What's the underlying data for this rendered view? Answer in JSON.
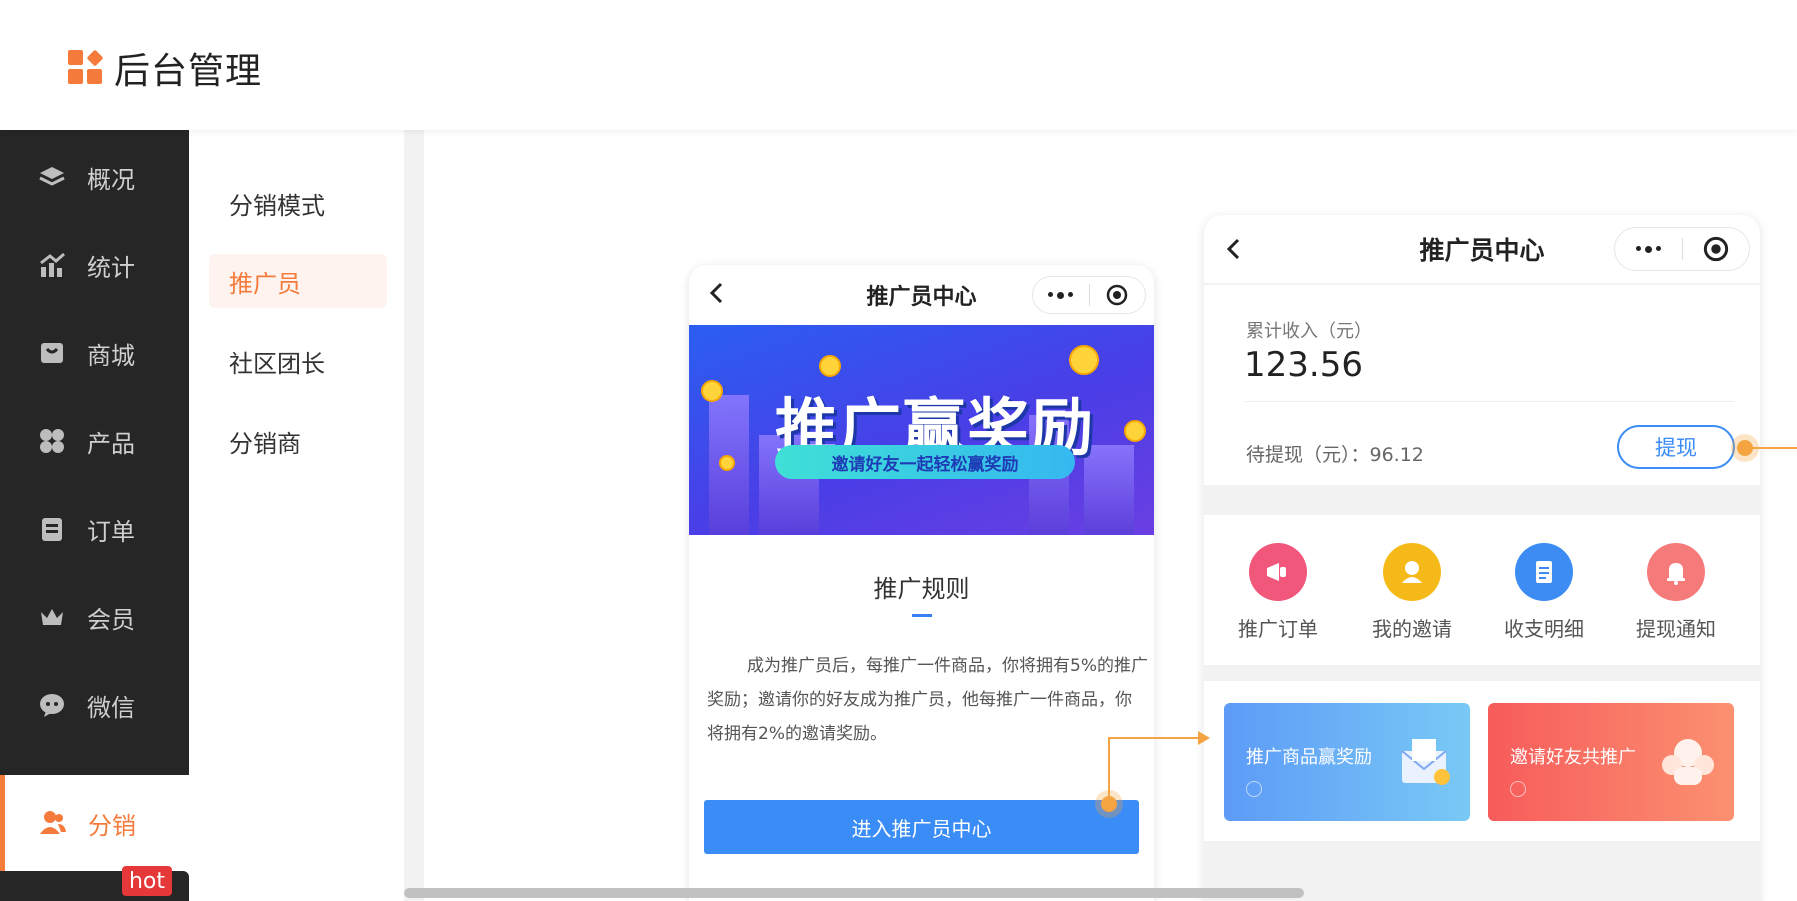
{
  "header": {
    "title": "后台管理"
  },
  "nav": {
    "items": [
      {
        "label": "概况",
        "icon": "layers-icon"
      },
      {
        "label": "统计",
        "icon": "chart-icon"
      },
      {
        "label": "商城",
        "icon": "store-icon"
      },
      {
        "label": "产品",
        "icon": "grid-icon"
      },
      {
        "label": "订单",
        "icon": "clipboard-icon"
      },
      {
        "label": "会员",
        "icon": "crown-icon"
      },
      {
        "label": "微信",
        "icon": "wechat-icon"
      },
      {
        "label": "分销",
        "icon": "users-icon"
      }
    ],
    "hot_badge": "hot"
  },
  "submenu": {
    "items": [
      {
        "label": "分销模式"
      },
      {
        "label": "推广员"
      },
      {
        "label": "社区团长"
      },
      {
        "label": "分销商"
      }
    ],
    "active": "推广员"
  },
  "phone_a": {
    "title": "推广员中心",
    "banner_title": "推广赢奖励",
    "banner_subtitle": "邀请好友一起轻松赢奖励",
    "rule_title": "推广规则",
    "rule_text": "成为推广员后，每推广一件商品，你将拥有5%的推广奖励；邀请你的好友成为推广员，他每推广一件商品，你将拥有2%的邀请奖励。",
    "enter_button": "进入推广员中心"
  },
  "phone_b": {
    "title": "推广员中心",
    "earnings_label": "累计收入（元）",
    "earnings_value": "123.56",
    "pending_label": "待提现（元）：96.12",
    "withdraw_button": "提现",
    "shortcuts": [
      {
        "label": "推广订单",
        "icon": "megaphone-icon",
        "color": "#f0577a"
      },
      {
        "label": "我的邀请",
        "icon": "invite-icon",
        "color": "#f6b91a"
      },
      {
        "label": "收支明细",
        "icon": "ledger-icon",
        "color": "#3c8cf3"
      },
      {
        "label": "提现通知",
        "icon": "bell-icon",
        "color": "#f57a7a"
      }
    ],
    "cards": [
      {
        "label": "推广商品赢奖励",
        "color": "#5aa2f8"
      },
      {
        "label": "邀请好友共推广",
        "color": "#f86a5c"
      }
    ]
  },
  "colors": {
    "accent": "#f57b3c",
    "blue": "#3a8cf6",
    "nav_bg": "#262626"
  }
}
